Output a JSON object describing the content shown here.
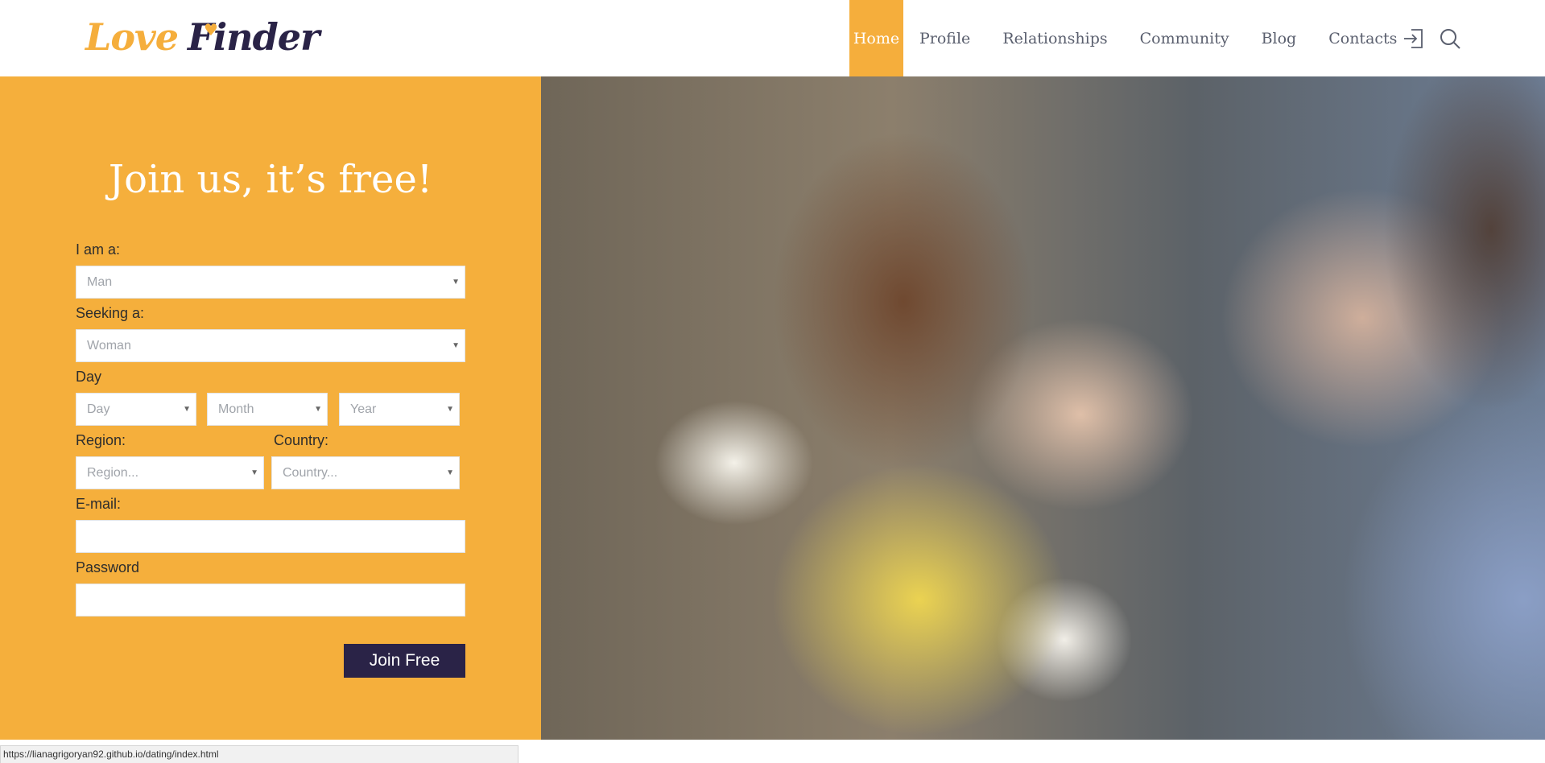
{
  "brand": {
    "logo_word1": "Love",
    "logo_word2": "Finder",
    "accent": "#f5ae3c",
    "dark": "#2a2347"
  },
  "nav": {
    "items": [
      "Home",
      "Profile",
      "Relationships",
      "Community",
      "Blog",
      "Contacts"
    ],
    "active": "Home",
    "icons": [
      "login-icon",
      "search-icon"
    ]
  },
  "form": {
    "title": "Join us, it’s free!",
    "iam_label": "I am a:",
    "iam_value": "Man",
    "seeking_label": "Seeking a:",
    "seeking_value": "Woman",
    "birth_label": "Day",
    "day_value": "Day",
    "month_value": "Month",
    "year_value": "Year",
    "region_label": "Region:",
    "region_value": "Region...",
    "country_label": "Country:",
    "country_value": "Country...",
    "email_label": "E-mail:",
    "email_value": "",
    "password_label": "Password",
    "password_value": "",
    "submit_label": "Join Free"
  },
  "status_bar": {
    "url": "https://lianagrigoryan92.github.io/dating/index.html"
  }
}
